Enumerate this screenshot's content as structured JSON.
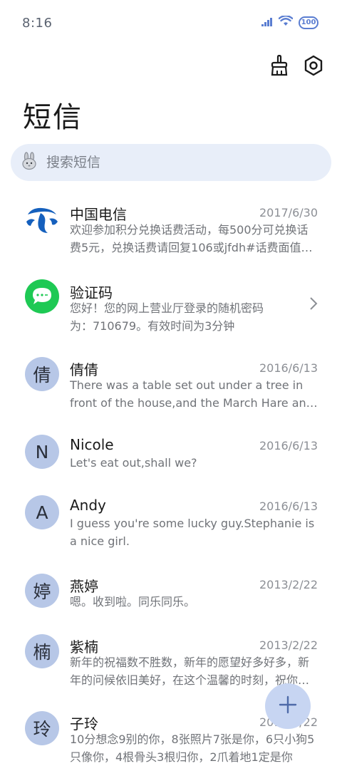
{
  "status": {
    "time": "8:16",
    "battery": "100"
  },
  "header": {
    "title": "短信"
  },
  "search": {
    "placeholder": "搜索短信"
  },
  "conversations": [
    {
      "name": "中国电信",
      "date": "2017/6/30",
      "preview": "欢迎参加积分兑换话费活动，每500分可兑换话费5元，兑换话费请回复106或jfdh#话费面值#兑换次数",
      "avatar": "telecom-logo"
    },
    {
      "name": "验证码",
      "date": "",
      "preview": "您好！您的网上营业厅登录的随机密码为：710679。有效时间为3分钟",
      "avatar": "message-bubble-icon"
    },
    {
      "name": "倩倩",
      "date": "2016/6/13",
      "preview": "There was a table set out under a tree in front of the house,and the March Hare and the Hatter were having tea",
      "avatar": "倩"
    },
    {
      "name": "Nicole",
      "date": "2016/6/13",
      "preview": "Let's eat out,shall we?",
      "avatar": "N"
    },
    {
      "name": "Andy",
      "date": "2016/6/13",
      "preview": "I guess you're some lucky guy.Stephanie is a nice girl.",
      "avatar": "A"
    },
    {
      "name": "燕婷",
      "date": "2013/2/22",
      "preview": "嗯。收到啦。同乐同乐。",
      "avatar": "婷"
    },
    {
      "name": "紫楠",
      "date": "2013/2/22",
      "preview": "新年的祝福数不胜数，新年的愿望好多好多，新年的问候依旧美好，在这个温馨的时刻，祝你新年快乐",
      "avatar": "楠"
    },
    {
      "name": "子玲",
      "date": "2013/2/22",
      "preview": "10分想念9别的你，8张照片7张是你，6只小狗5只像你，4根骨头3根归你，2爪着地1定是你",
      "avatar": "玲"
    }
  ],
  "colors": {
    "accent": "#5a7dd1",
    "avatar_bg": "#b7c7e7",
    "search_bg": "#e8eef9",
    "fab_bg": "#c7d5f2",
    "green": "#1ec954"
  }
}
